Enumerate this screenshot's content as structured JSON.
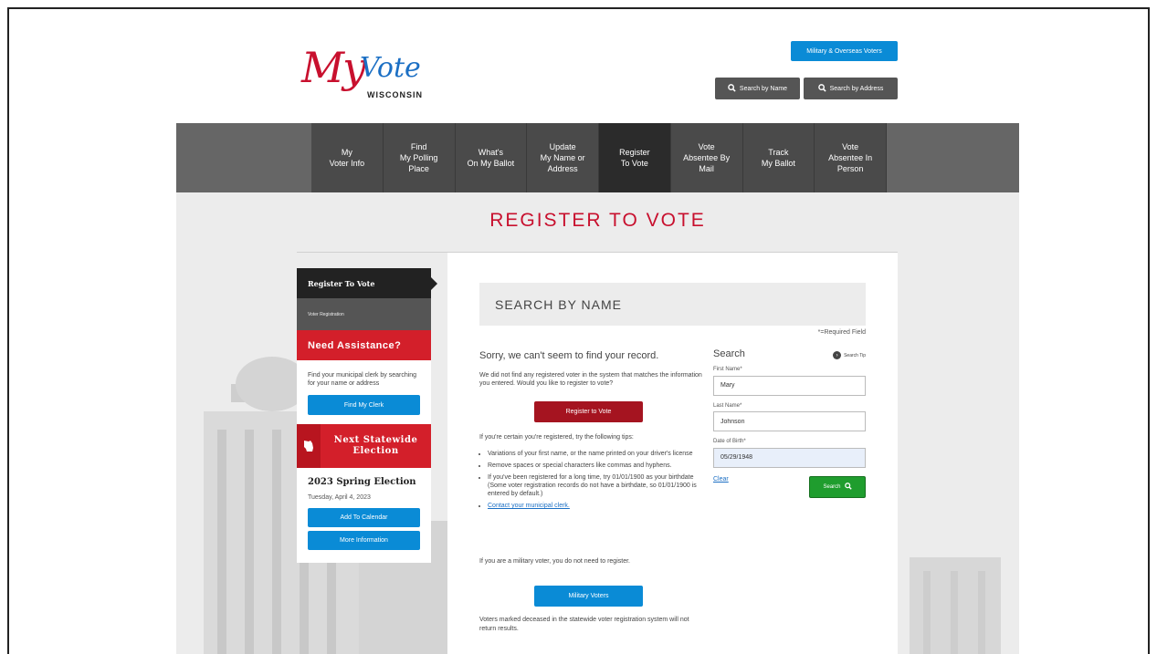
{
  "logo": {
    "my": "My",
    "vote": "Vote",
    "state": "WISCONSIN"
  },
  "header": {
    "military_label": "Military & Overseas Voters",
    "search_name_label": "Search by Name",
    "search_address_label": "Search by Address"
  },
  "nav": {
    "items": [
      {
        "label": "My\nVoter Info"
      },
      {
        "label": "Find\nMy Polling\nPlace"
      },
      {
        "label": "What's\nOn My Ballot"
      },
      {
        "label": "Update\nMy Name or\nAddress"
      },
      {
        "label": "Register\nTo Vote"
      },
      {
        "label": "Vote\nAbsentee By\nMail"
      },
      {
        "label": "Track\nMy Ballot"
      },
      {
        "label": "Vote\nAbsentee In\nPerson"
      }
    ],
    "active_index": 4
  },
  "page": {
    "title": "REGISTER TO VOTE"
  },
  "sidebar": {
    "register_label": "Register To Vote",
    "voter_registration_label": "Voter Registration",
    "assistance_title": "Need Assistance?",
    "assistance_text": "Find your municipal clerk by searching for your name or address",
    "find_clerk_label": "Find My Clerk",
    "next_election_title": "Next Statewide Election",
    "election_name": "2023 Spring Election",
    "election_date": "Tuesday, April 4, 2023",
    "add_calendar_label": "Add To Calendar",
    "more_info_label": "More Information"
  },
  "main": {
    "section_title": "SEARCH BY NAME",
    "required_note": "*=Required Field",
    "sorry_heading": "Sorry, we can't seem to find your record.",
    "not_found_text": "We did not find any registered voter in the system that matches the information you entered. Would you like to register to vote?",
    "register_button": "Register to Vote",
    "tips_intro": "If you're certain you're registered, try the following tips:",
    "tips": [
      "Variations of your first name, or the name printed on your driver's license",
      "Remove spaces or special characters like commas and hyphens.",
      "If you've been registered for a long time, try 01/01/1900 as your birthdate (Some voter registration records do not have a birthdate, so 01/01/1900 is entered by default.)"
    ],
    "contact_link": "Contact your municipal clerk.",
    "military_text": "If you are a military voter, you do not need to register.",
    "military_button": "Military Voters",
    "deceased_text": "Voters marked deceased in the statewide voter registration system will not return results."
  },
  "form": {
    "title": "Search",
    "tip_label": "Search Tip",
    "first_name_label": "First Name*",
    "first_name_value": "Mary",
    "last_name_label": "Last Name*",
    "last_name_value": "Johnson",
    "dob_label": "Date of Birth*",
    "dob_value": "05/29/1948",
    "clear_label": "Clear",
    "search_button": "Search"
  }
}
